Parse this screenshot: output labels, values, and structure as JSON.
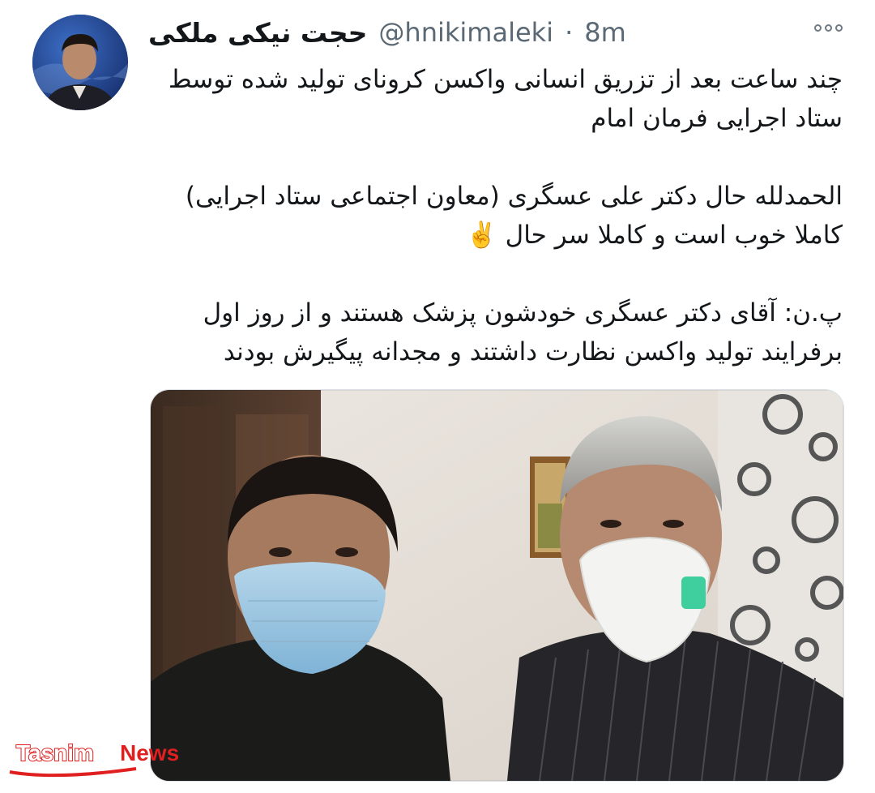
{
  "tweet": {
    "display_name": "حجت نیکی ملکی",
    "handle": "@hnikimaleki",
    "separator": "·",
    "time": "8m",
    "paragraphs": [
      "چند ساعت بعد از تزریق انسانی واکسن کرونای تولید شده توسط ستاد اجرایی فرمان امام",
      "الحمدلله حال دکتر علی عسگری (معاون اجتماعی ستاد اجرایی) کاملا خوب است و کاملا سر حال ✌️",
      "پ.ن: آقای دکتر عسگری خودشون پزشک هستند و از روز اول برفرایند تولید واکسن نظارت داشتند و مجدانه پیگیرش بودند"
    ],
    "more_icon": "more-options-icon"
  },
  "watermark": {
    "brand": "Tasnim",
    "suffix": "News"
  },
  "colors": {
    "text": "#14171a",
    "muted": "#5b6975",
    "brand_red": "#e02020"
  }
}
